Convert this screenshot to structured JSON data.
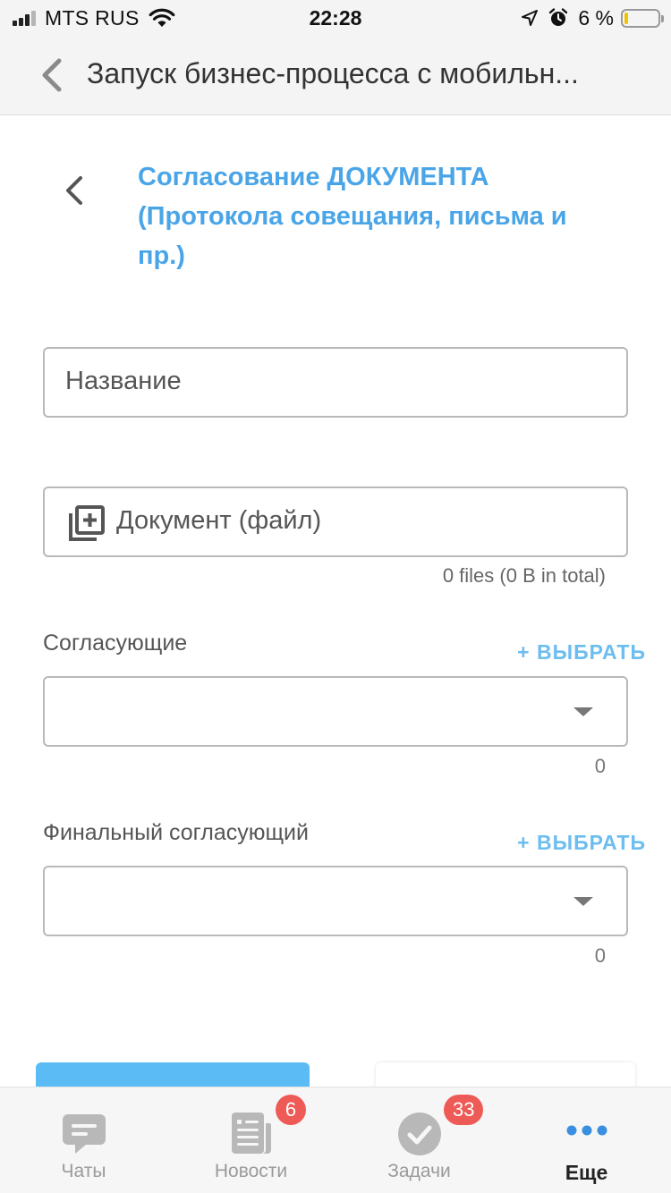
{
  "status_bar": {
    "carrier": "MTS RUS",
    "time": "22:28",
    "battery_percent": "6 %"
  },
  "nav": {
    "title": "Запуск бизнес-процесса с мобильн..."
  },
  "form": {
    "title": "Согласование ДОКУМЕНТА (Протокола совещания, письма и пр.)",
    "name_placeholder": "Название",
    "document_placeholder": "Документ (файл)",
    "files_info": "0 files (0 B in total)",
    "approvers": {
      "label": "Согласующие",
      "select_link": "+ ВЫБРАТЬ",
      "count": "0"
    },
    "final_approver": {
      "label": "Финальный согласующий",
      "select_link": "+ ВЫБРАТЬ",
      "count": "0"
    }
  },
  "tab_bar": {
    "tabs": [
      {
        "label": "Чаты",
        "icon": "chat-icon",
        "badge": ""
      },
      {
        "label": "Новости",
        "icon": "news-icon",
        "badge": "6"
      },
      {
        "label": "Задачи",
        "icon": "tasks-icon",
        "badge": "33"
      },
      {
        "label": "Еще",
        "icon": "more-icon",
        "badge": ""
      }
    ],
    "active": "Еще"
  },
  "colors": {
    "accent": "#4aa5e8",
    "link": "#6cbdf0",
    "badge": "#ee5a55",
    "primary_button": "#5bbcf5"
  }
}
